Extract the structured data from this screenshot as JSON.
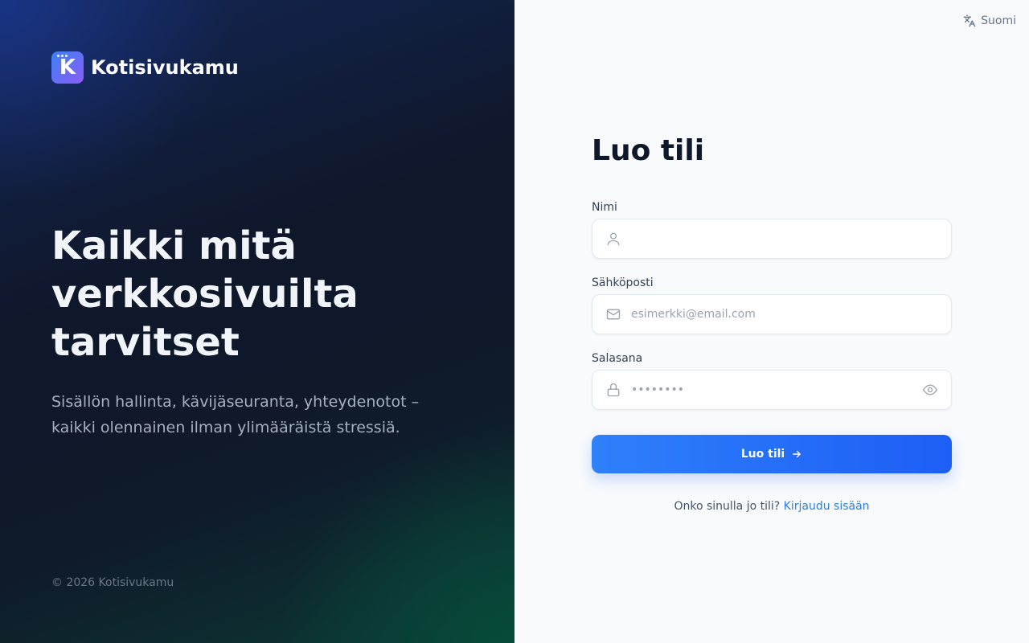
{
  "brand": {
    "name": "Kotisivukamu",
    "logo_letter": "K",
    "logo_gradient": [
      "#3b82f6",
      "#8b5cf6"
    ]
  },
  "hero": {
    "headline_line1": "Kaikki mitä",
    "headline_line2": "verkkosivuilta",
    "headline_line3": "tarvitset",
    "subtitle_line1": "Sisällön hallinta, kävijäseuranta, yhteydenotot –",
    "subtitle_line2": "kaikki olennainen ilman ylimääräistä stressiä."
  },
  "footer": {
    "copyright": "© 2026 Kotisivukamu"
  },
  "language": {
    "label": "Suomi",
    "icon": "translate-icon"
  },
  "form": {
    "title": "Luo tili",
    "name_field": {
      "label": "Nimi",
      "value": "",
      "placeholder": "",
      "icon": "user-icon"
    },
    "email_field": {
      "label": "Sähköposti",
      "value": "",
      "placeholder": "esimerkki@email.com",
      "icon": "mail-icon"
    },
    "password_field": {
      "label": "Salasana",
      "value": "",
      "placeholder": "••••••••",
      "icon": "lock-icon",
      "toggle_icon": "eye-icon"
    },
    "submit_label": "Luo tili",
    "submit_icon": "arrow-right-icon",
    "signin_prompt": "Onko sinulla jo tili?",
    "signin_link": "Kirjaudu sisään"
  },
  "colors": {
    "accent": "#2563eb",
    "link": "#2b7fe6",
    "left_panel_base": "#0f172a",
    "right_panel_bg": "#f8fafc"
  }
}
